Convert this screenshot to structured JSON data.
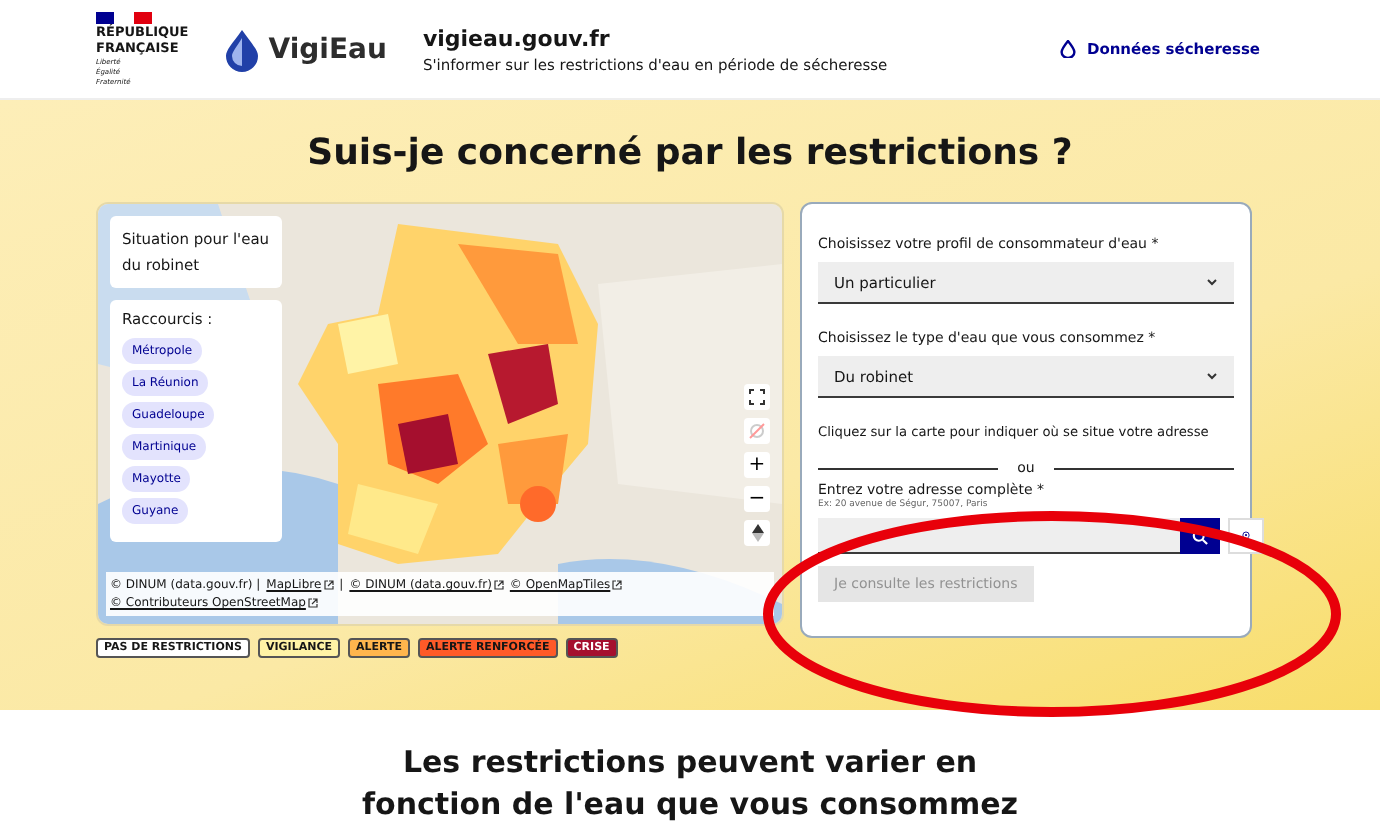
{
  "header": {
    "brand": [
      "RÉPUBLIQUE",
      "FRANÇAISE"
    ],
    "motto": [
      "Liberté",
      "Égalité",
      "Fraternité"
    ],
    "logo_text": "VigiEau",
    "site": "vigieau.gouv.fr",
    "tagline": "S'informer sur les restrictions d'eau en période de sécheresse",
    "link": "Données sécheresse"
  },
  "title": "Suis-je concerné par les restrictions ?",
  "map": {
    "kind": "picture",
    "situation": "Situation pour l'eau du robinet",
    "shortcuts_label": "Raccourcis :",
    "shortcuts": [
      "Métropole",
      "La Réunion",
      "Guadeloupe",
      "Martinique",
      "Mayotte",
      "Guyane"
    ],
    "controls": [
      "+",
      "−"
    ],
    "attribution": [
      {
        "text": "© DINUM (data.gouv.fr) |",
        "link": false
      },
      {
        "text": "MapLibre",
        "link": true
      },
      {
        "text": "|",
        "link": false
      },
      {
        "text": "© DINUM (data.gouv.fr)",
        "link": true
      },
      {
        "text": "© OpenMapTiles",
        "link": true
      },
      {
        "text": "© Contributeurs OpenStreetMap",
        "link": true
      }
    ]
  },
  "legend": [
    {
      "label": "PAS DE RESTRICTIONS",
      "color": "#ffffff"
    },
    {
      "label": "VIGILANCE",
      "color": "#fff3a6"
    },
    {
      "label": "ALERTE",
      "color": "#ffb54d"
    },
    {
      "label": "ALERTE RENFORCÉE",
      "color": "#ff5a28"
    },
    {
      "label": "CRISE",
      "color": "#a50f2e"
    }
  ],
  "form": {
    "profile_label": "Choisissez votre profil de consommateur d'eau *",
    "profile_value": "Un particulier",
    "water_label": "Choisissez le type d'eau que vous consommez *",
    "water_value": "Du robinet",
    "map_hint": "Cliquez sur la carte pour indiquer où se situe votre adresse",
    "or": "ou",
    "address_label": "Entrez votre adresse complète *",
    "address_hint": "Ex: 20 avenue de Ségur, 75007, Paris",
    "submit": "Je consulte les restrictions",
    "submit_disabled": true
  },
  "subtitle": "Les restrictions peuvent varier en fonction de l'eau que vous consommez"
}
